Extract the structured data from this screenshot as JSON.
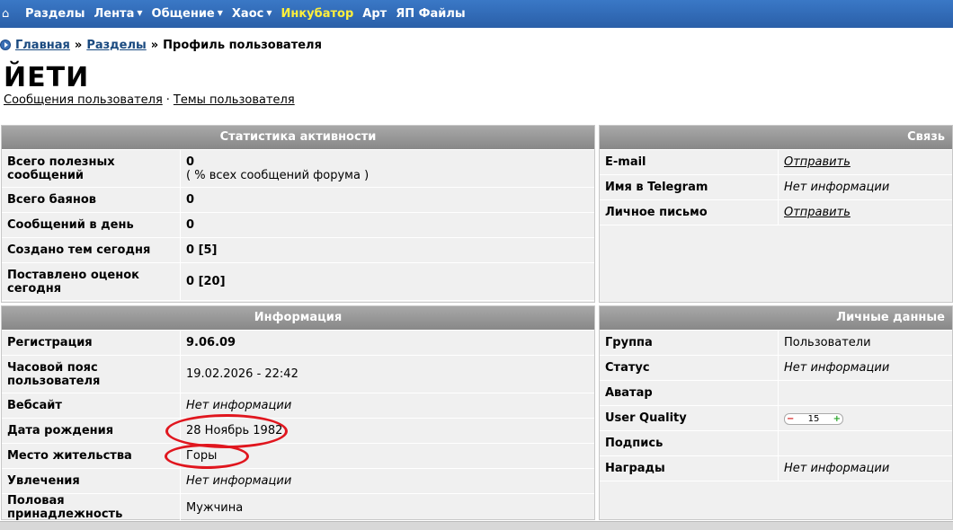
{
  "nav": {
    "items": [
      {
        "label": "Разделы",
        "dropdown": false,
        "highlight": false
      },
      {
        "label": "Лента",
        "dropdown": true,
        "highlight": false
      },
      {
        "label": "Общение",
        "dropdown": true,
        "highlight": false
      },
      {
        "label": "Хаос",
        "dropdown": true,
        "highlight": false
      },
      {
        "label": "Инкубатор",
        "dropdown": false,
        "highlight": true
      },
      {
        "label": "Арт",
        "dropdown": false,
        "highlight": false
      },
      {
        "label": "ЯП Файлы",
        "dropdown": false,
        "highlight": false
      }
    ]
  },
  "breadcrumb": {
    "home": "Главная",
    "sections": "Разделы",
    "current": "Профиль пользователя",
    "separator": "»"
  },
  "profile": {
    "username": "ЙЕТИ",
    "link_posts": "Сообщения пользователя",
    "link_topics": "Темы пользователя",
    "link_sep": "·"
  },
  "stats": {
    "title": "Статистика активности",
    "rows": [
      {
        "label": "Всего полезных сообщений",
        "value": "0",
        "sub": "( % всех сообщений форума )"
      },
      {
        "label": "Всего баянов",
        "value": "0"
      },
      {
        "label": "Сообщений в день",
        "value": "0"
      },
      {
        "label": "Создано тем сегодня",
        "value": "0 [5]"
      },
      {
        "label": "Поставлено оценок сегодня",
        "value": "0 [20]"
      }
    ]
  },
  "contact": {
    "title": "Связь",
    "rows": [
      {
        "label": "E-mail",
        "value": "Отправить"
      },
      {
        "label": "Имя в Telegram",
        "value": "Нет информации"
      },
      {
        "label": "Личное письмо",
        "value": "Отправить"
      }
    ]
  },
  "info": {
    "title": "Информация",
    "rows": [
      {
        "label": "Регистрация",
        "value": "9.06.09"
      },
      {
        "label": "Часовой пояс пользователя",
        "value": "19.02.2026 - 22:42"
      },
      {
        "label": "Вебсайт",
        "value": "Нет информации"
      },
      {
        "label": "Дата рождения",
        "value": "28 Ноябрь 1982"
      },
      {
        "label": "Место жительства",
        "value": "Горы"
      },
      {
        "label": "Увлечения",
        "value": "Нет информации"
      },
      {
        "label": "Половая принадлежность",
        "value": "Мужчина"
      }
    ]
  },
  "personal": {
    "title": "Личные данные",
    "rows": [
      {
        "label": "Группа",
        "value": "Пользователи"
      },
      {
        "label": "Статус",
        "value": "Нет информации"
      },
      {
        "label": "Аватар",
        "value": ""
      },
      {
        "label": "User Quality",
        "value": "15",
        "minus": "−",
        "plus": "+"
      },
      {
        "label": "Подпись",
        "value": ""
      },
      {
        "label": "Награды",
        "value": "Нет информации"
      }
    ]
  },
  "colors": {
    "nav_bg": "#2f68b4",
    "nav_highlight": "#ffef3c",
    "panel_header": "#999999",
    "annotation": "#e0161e"
  }
}
